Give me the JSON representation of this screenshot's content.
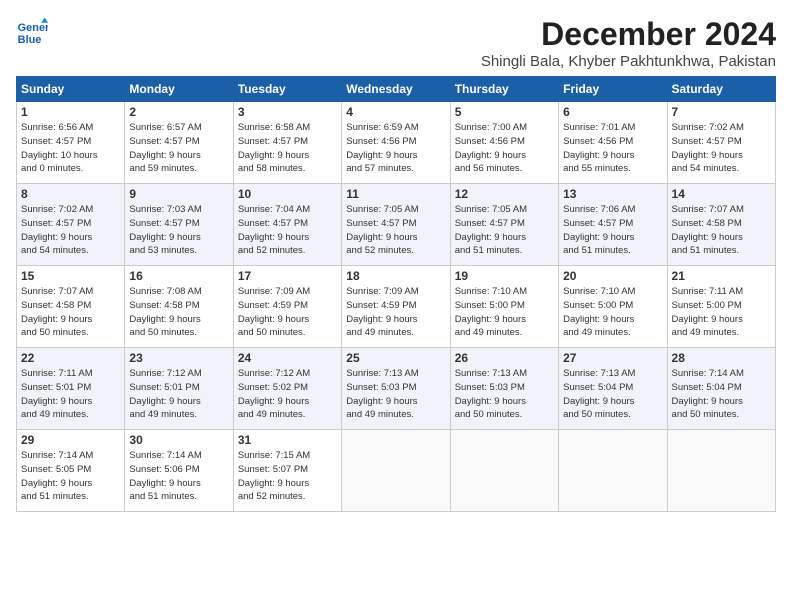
{
  "header": {
    "logo_line1": "General",
    "logo_line2": "Blue",
    "month": "December 2024",
    "location": "Shingli Bala, Khyber Pakhtunkhwa, Pakistan"
  },
  "days_of_week": [
    "Sunday",
    "Monday",
    "Tuesday",
    "Wednesday",
    "Thursday",
    "Friday",
    "Saturday"
  ],
  "weeks": [
    [
      {
        "day": 1,
        "info": "Sunrise: 6:56 AM\nSunset: 4:57 PM\nDaylight: 10 hours\nand 0 minutes."
      },
      {
        "day": 2,
        "info": "Sunrise: 6:57 AM\nSunset: 4:57 PM\nDaylight: 9 hours\nand 59 minutes."
      },
      {
        "day": 3,
        "info": "Sunrise: 6:58 AM\nSunset: 4:57 PM\nDaylight: 9 hours\nand 58 minutes."
      },
      {
        "day": 4,
        "info": "Sunrise: 6:59 AM\nSunset: 4:56 PM\nDaylight: 9 hours\nand 57 minutes."
      },
      {
        "day": 5,
        "info": "Sunrise: 7:00 AM\nSunset: 4:56 PM\nDaylight: 9 hours\nand 56 minutes."
      },
      {
        "day": 6,
        "info": "Sunrise: 7:01 AM\nSunset: 4:56 PM\nDaylight: 9 hours\nand 55 minutes."
      },
      {
        "day": 7,
        "info": "Sunrise: 7:02 AM\nSunset: 4:57 PM\nDaylight: 9 hours\nand 54 minutes."
      }
    ],
    [
      {
        "day": 8,
        "info": "Sunrise: 7:02 AM\nSunset: 4:57 PM\nDaylight: 9 hours\nand 54 minutes."
      },
      {
        "day": 9,
        "info": "Sunrise: 7:03 AM\nSunset: 4:57 PM\nDaylight: 9 hours\nand 53 minutes."
      },
      {
        "day": 10,
        "info": "Sunrise: 7:04 AM\nSunset: 4:57 PM\nDaylight: 9 hours\nand 52 minutes."
      },
      {
        "day": 11,
        "info": "Sunrise: 7:05 AM\nSunset: 4:57 PM\nDaylight: 9 hours\nand 52 minutes."
      },
      {
        "day": 12,
        "info": "Sunrise: 7:05 AM\nSunset: 4:57 PM\nDaylight: 9 hours\nand 51 minutes."
      },
      {
        "day": 13,
        "info": "Sunrise: 7:06 AM\nSunset: 4:57 PM\nDaylight: 9 hours\nand 51 minutes."
      },
      {
        "day": 14,
        "info": "Sunrise: 7:07 AM\nSunset: 4:58 PM\nDaylight: 9 hours\nand 51 minutes."
      }
    ],
    [
      {
        "day": 15,
        "info": "Sunrise: 7:07 AM\nSunset: 4:58 PM\nDaylight: 9 hours\nand 50 minutes."
      },
      {
        "day": 16,
        "info": "Sunrise: 7:08 AM\nSunset: 4:58 PM\nDaylight: 9 hours\nand 50 minutes."
      },
      {
        "day": 17,
        "info": "Sunrise: 7:09 AM\nSunset: 4:59 PM\nDaylight: 9 hours\nand 50 minutes."
      },
      {
        "day": 18,
        "info": "Sunrise: 7:09 AM\nSunset: 4:59 PM\nDaylight: 9 hours\nand 49 minutes."
      },
      {
        "day": 19,
        "info": "Sunrise: 7:10 AM\nSunset: 5:00 PM\nDaylight: 9 hours\nand 49 minutes."
      },
      {
        "day": 20,
        "info": "Sunrise: 7:10 AM\nSunset: 5:00 PM\nDaylight: 9 hours\nand 49 minutes."
      },
      {
        "day": 21,
        "info": "Sunrise: 7:11 AM\nSunset: 5:00 PM\nDaylight: 9 hours\nand 49 minutes."
      }
    ],
    [
      {
        "day": 22,
        "info": "Sunrise: 7:11 AM\nSunset: 5:01 PM\nDaylight: 9 hours\nand 49 minutes."
      },
      {
        "day": 23,
        "info": "Sunrise: 7:12 AM\nSunset: 5:01 PM\nDaylight: 9 hours\nand 49 minutes."
      },
      {
        "day": 24,
        "info": "Sunrise: 7:12 AM\nSunset: 5:02 PM\nDaylight: 9 hours\nand 49 minutes."
      },
      {
        "day": 25,
        "info": "Sunrise: 7:13 AM\nSunset: 5:03 PM\nDaylight: 9 hours\nand 49 minutes."
      },
      {
        "day": 26,
        "info": "Sunrise: 7:13 AM\nSunset: 5:03 PM\nDaylight: 9 hours\nand 50 minutes."
      },
      {
        "day": 27,
        "info": "Sunrise: 7:13 AM\nSunset: 5:04 PM\nDaylight: 9 hours\nand 50 minutes."
      },
      {
        "day": 28,
        "info": "Sunrise: 7:14 AM\nSunset: 5:04 PM\nDaylight: 9 hours\nand 50 minutes."
      }
    ],
    [
      {
        "day": 29,
        "info": "Sunrise: 7:14 AM\nSunset: 5:05 PM\nDaylight: 9 hours\nand 51 minutes."
      },
      {
        "day": 30,
        "info": "Sunrise: 7:14 AM\nSunset: 5:06 PM\nDaylight: 9 hours\nand 51 minutes."
      },
      {
        "day": 31,
        "info": "Sunrise: 7:15 AM\nSunset: 5:07 PM\nDaylight: 9 hours\nand 52 minutes."
      },
      {
        "day": null,
        "info": ""
      },
      {
        "day": null,
        "info": ""
      },
      {
        "day": null,
        "info": ""
      },
      {
        "day": null,
        "info": ""
      }
    ]
  ]
}
